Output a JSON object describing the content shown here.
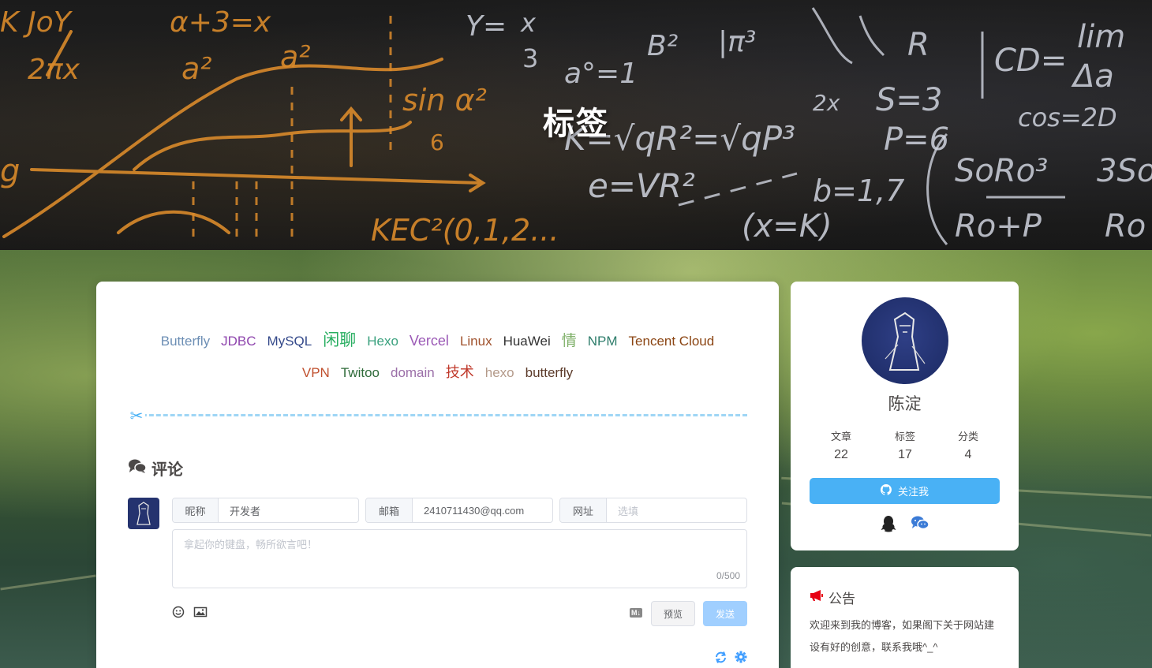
{
  "hero": {
    "title": "标签",
    "formula_texts": [
      "α+3=x",
      "2πx",
      "a²",
      "a²",
      "Y=x/3",
      "a°=1",
      "sin α²",
      "6",
      "B²",
      "|π³",
      "R",
      "S=3",
      "P=6",
      "K=√qR²=√qP³",
      "e=VR²",
      "KEC²(0,1,2...",
      "(x=K)",
      "b=1,7",
      "CD=lim Δa",
      "cos=2D",
      "SoRo³",
      "Ro+P",
      "3So",
      "Ro"
    ]
  },
  "tags": [
    {
      "label": "Butterfly",
      "color": "#6d8fb5",
      "size": 17
    },
    {
      "label": "JDBC",
      "color": "#8e44ad",
      "size": 17
    },
    {
      "label": "MySQL",
      "color": "#34498a",
      "size": 17
    },
    {
      "label": "闲聊",
      "color": "#27ae60",
      "size": 21
    },
    {
      "label": "Hexo",
      "color": "#3aa17e",
      "size": 17
    },
    {
      "label": "Vercel",
      "color": "#9b59b6",
      "size": 18
    },
    {
      "label": "Linux",
      "color": "#a0522d",
      "size": 17
    },
    {
      "label": "HuaWei",
      "color": "#333333",
      "size": 17
    },
    {
      "label": "情",
      "color": "#7fb069",
      "size": 19
    },
    {
      "label": "NPM",
      "color": "#2e7d6b",
      "size": 17
    },
    {
      "label": "Tencent Cloud",
      "color": "#8b4513",
      "size": 17
    },
    {
      "label": "VPN",
      "color": "#c0502e",
      "size": 17
    },
    {
      "label": "Twitoo",
      "color": "#2f6b3a",
      "size": 17
    },
    {
      "label": "domain",
      "color": "#9b6fa8",
      "size": 17
    },
    {
      "label": "技术",
      "color": "#c0392b",
      "size": 18
    },
    {
      "label": "hexo",
      "color": "#b49a8a",
      "size": 17
    },
    {
      "label": "butterfly",
      "color": "#5b3a29",
      "size": 17
    }
  ],
  "comment": {
    "title": "评论",
    "nickname_label": "昵称",
    "nickname_value": "开发者",
    "email_label": "邮箱",
    "email_value": "2410711430@qq.com",
    "url_label": "网址",
    "url_placeholder": "选填",
    "textarea_placeholder": "拿起你的键盘，畅所欲言吧！",
    "counter": "0/500",
    "md_badge": "M↓",
    "preview_label": "预览",
    "send_label": "发送"
  },
  "author": {
    "name": "陈淀",
    "stats": [
      {
        "label": "文章",
        "value": "22"
      },
      {
        "label": "标签",
        "value": "17"
      },
      {
        "label": "分类",
        "value": "4"
      }
    ],
    "follow_label": "关注我"
  },
  "notice": {
    "title": "公告",
    "text": "欢迎来到我的博客，如果阁下关于网站建设有好的创意，联系我哦^_^"
  },
  "colors": {
    "accent": "#49b1f5",
    "send_disabled": "#a0cfff",
    "notice_icon": "#e60012"
  }
}
